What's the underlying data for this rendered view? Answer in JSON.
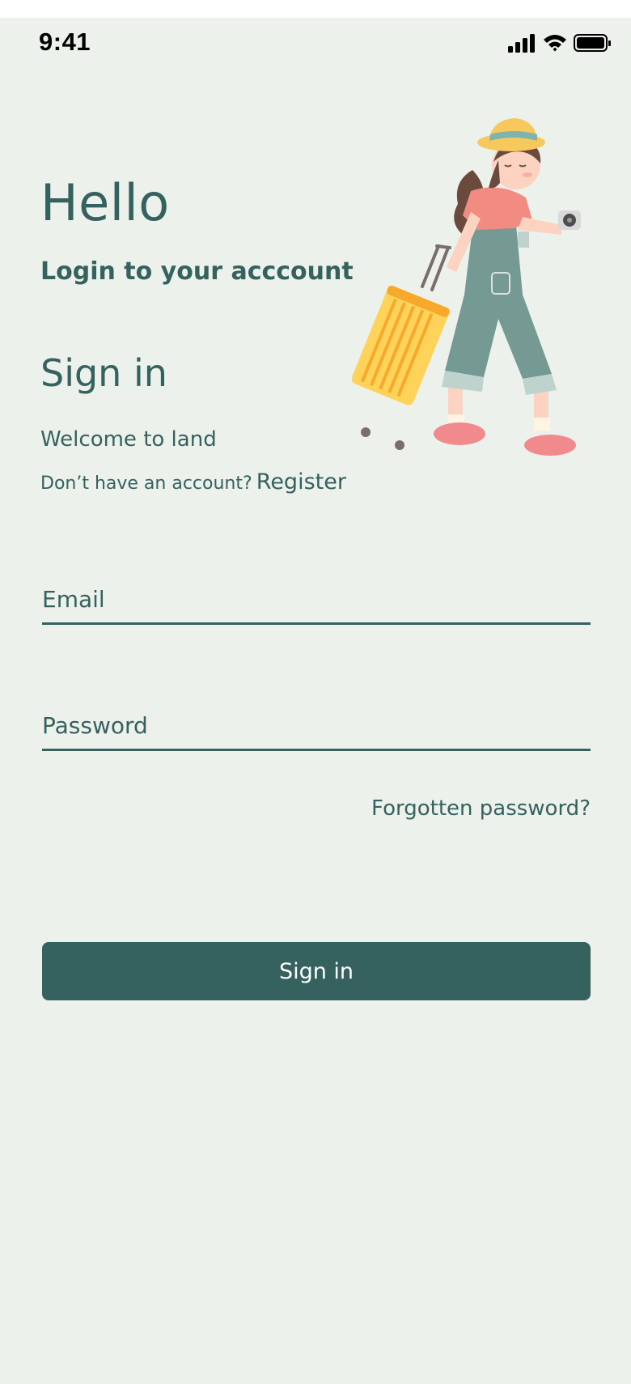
{
  "status_bar": {
    "time": "9:41",
    "icons": [
      "cellular-signal-icon",
      "wifi-icon",
      "battery-icon"
    ]
  },
  "header": {
    "greeting": "Hello",
    "subtitle": "Login to your acccount"
  },
  "illustration": {
    "name": "traveler-with-suitcase-illustration"
  },
  "signin": {
    "title": "Sign in",
    "welcome": "Welcome to land",
    "register_prompt": "Don’t have an account?",
    "register_link": "Register"
  },
  "form": {
    "email": {
      "placeholder": "Email",
      "value": ""
    },
    "password": {
      "placeholder": "Password",
      "value": ""
    },
    "forgot_password": "Forgotten password?",
    "submit_label": "Sign in"
  },
  "colors": {
    "background": "#EDF1EC",
    "primary": "#35615E",
    "button_text": "#FFFFFF"
  }
}
